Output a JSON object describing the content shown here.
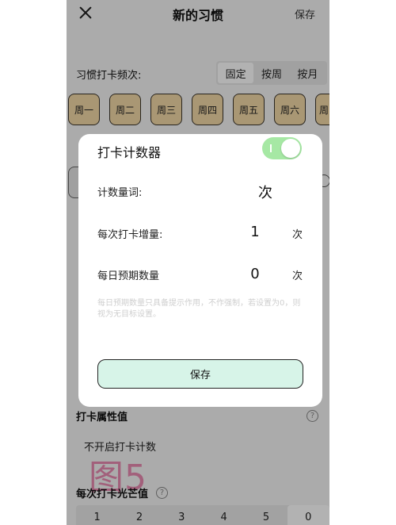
{
  "header": {
    "title": "新的习惯",
    "save_label": "保存"
  },
  "frequency": {
    "label": "习惯打卡频次:",
    "tabs": [
      "固定",
      "按周",
      "按月"
    ],
    "active_tab": "固定",
    "days": [
      "周一",
      "周二",
      "周三",
      "周四",
      "周五",
      "周六",
      "周"
    ]
  },
  "modal": {
    "title": "打卡计数器",
    "toggle_on": true,
    "rows": [
      {
        "label": "计数量词:",
        "value": "次",
        "unit": ""
      },
      {
        "label": "每次打卡增量:",
        "value": "1",
        "unit": "次"
      },
      {
        "label": "每日预期数量",
        "value": "0",
        "unit": "次"
      }
    ],
    "hint": "每日预期数量只具备提示作用，不作强制，若设置为0，则视为无目标设置。",
    "save_label": "保存"
  },
  "attribute": {
    "label": "打卡属性值",
    "value": "不开启打卡计数",
    "help": "?"
  },
  "watermark": "图5",
  "glow": {
    "label": "每次打卡光芒值",
    "help": "?",
    "options": [
      "1",
      "2",
      "3",
      "4",
      "5",
      "0"
    ],
    "selected": "0"
  },
  "colors": {
    "day_chip": "#f2d8a6",
    "toggle_on": "#a6e8a4",
    "save_button": "#d7f4e8",
    "watermark": "#e98ab0"
  }
}
